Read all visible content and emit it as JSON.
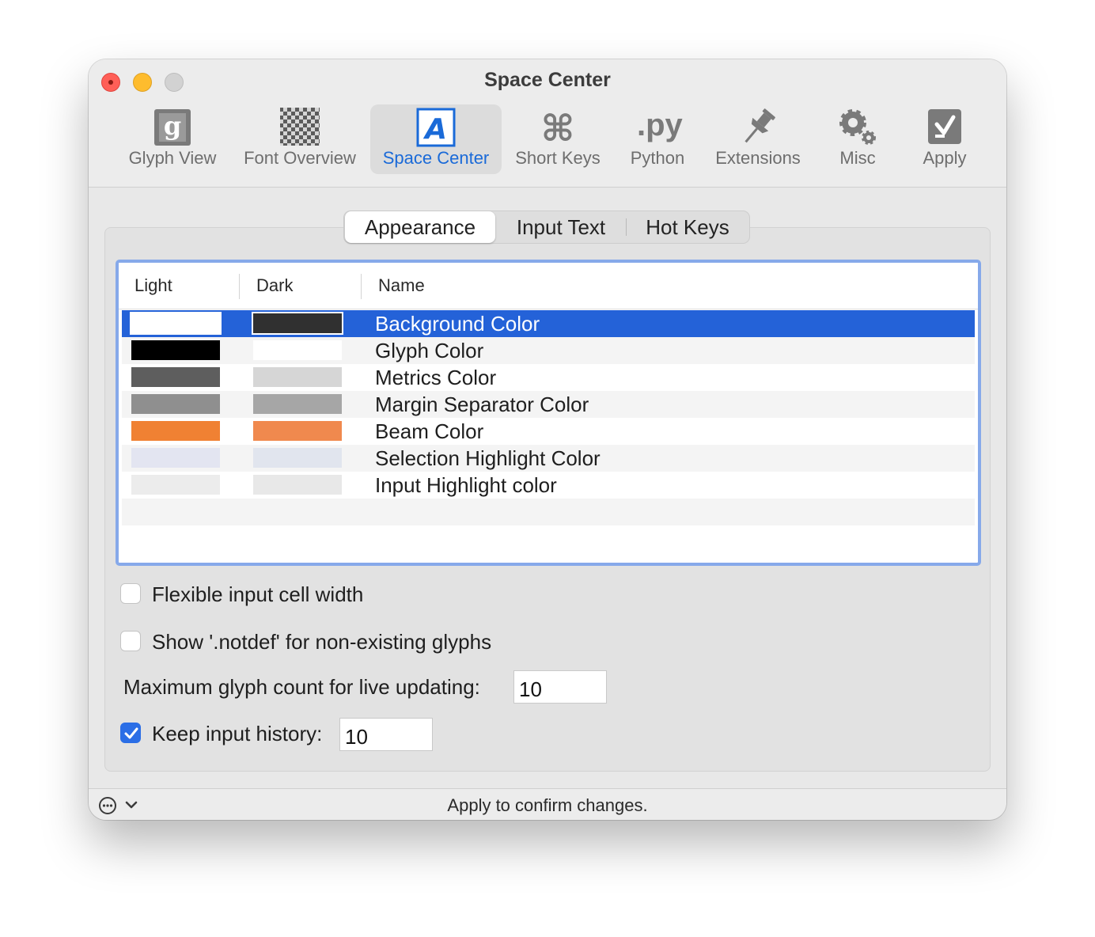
{
  "window": {
    "title": "Space Center"
  },
  "toolbar": {
    "items": [
      {
        "label": "Glyph View",
        "icon": "glyph-view-icon"
      },
      {
        "label": "Font Overview",
        "icon": "font-overview-icon"
      },
      {
        "label": "Space Center",
        "icon": "space-center-icon",
        "active": true
      },
      {
        "label": "Short Keys",
        "icon": "command-key-icon"
      },
      {
        "label": "Python",
        "icon": "python-icon",
        "glyph": ".py"
      },
      {
        "label": "Extensions",
        "icon": "pushpin-icon"
      },
      {
        "label": "Misc",
        "icon": "gears-icon"
      },
      {
        "label": "Apply",
        "icon": "apply-icon"
      }
    ]
  },
  "tabs": [
    {
      "label": "Appearance",
      "active": true
    },
    {
      "label": "Input Text"
    },
    {
      "label": "Hot Keys"
    }
  ],
  "table": {
    "columns": [
      "Light",
      "Dark",
      "Name"
    ],
    "rows": [
      {
        "name": "Background Color",
        "light": "#ffffff",
        "dark": "#303030",
        "selected": true
      },
      {
        "name": "Glyph Color",
        "light": "#000000",
        "dark": "#ffffff"
      },
      {
        "name": "Metrics Color",
        "light": "#5e5e5e",
        "dark": "#d6d6d6"
      },
      {
        "name": "Margin Separator Color",
        "light": "#8f8f8f",
        "dark": "#a6a6a6"
      },
      {
        "name": "Beam Color",
        "light": "#f08133",
        "dark": "#f0894e"
      },
      {
        "name": "Selection Highlight Color",
        "light": "#e3e5f1",
        "dark": "#e1e5ee"
      },
      {
        "name": "Input Highlight color",
        "light": "#ececec",
        "dark": "#e8e8e8"
      }
    ]
  },
  "options": {
    "flexible_width": {
      "label": "Flexible input cell width",
      "checked": false
    },
    "show_notdef": {
      "label": "Show '.notdef' for non-existing glyphs",
      "checked": false
    },
    "max_glyph": {
      "label": "Maximum glyph count for live updating:",
      "value": "10"
    },
    "keep_history": {
      "label": "Keep input history:",
      "checked": true,
      "value": "10"
    }
  },
  "status": {
    "text": "Apply to confirm changes."
  },
  "colors": {
    "accent": "#2462d8",
    "selection_border": "#86a9ea"
  }
}
